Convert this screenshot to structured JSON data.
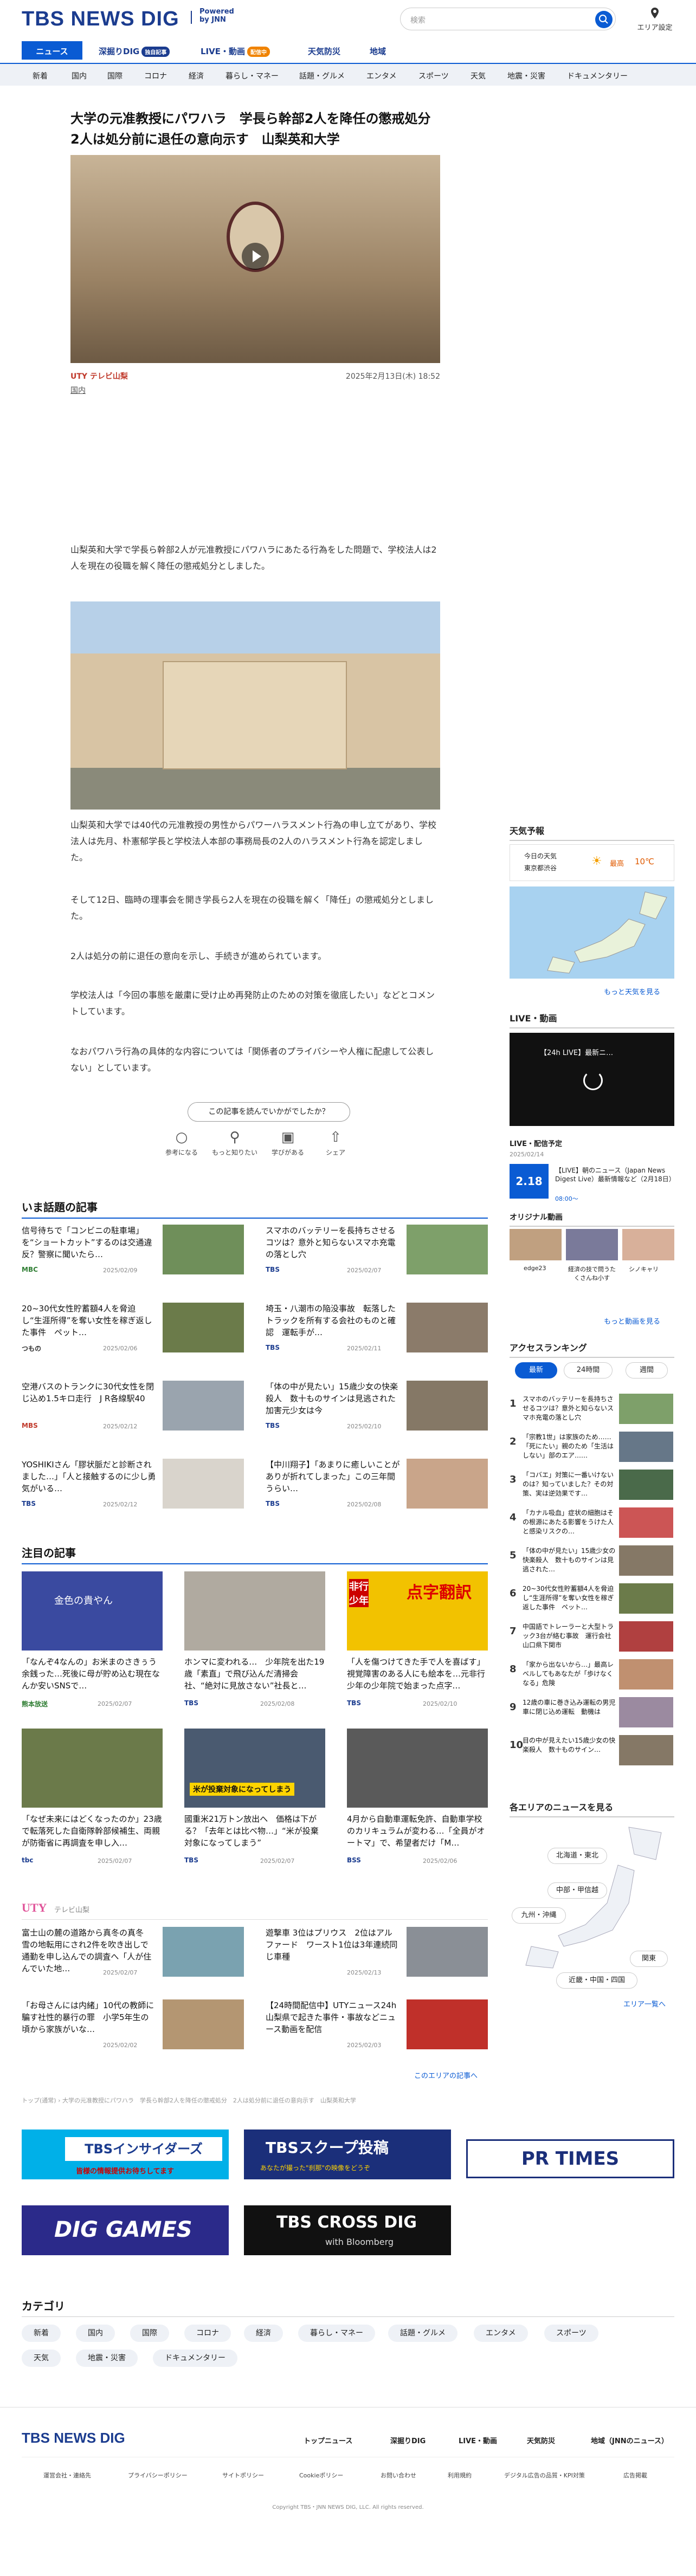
{
  "header": {
    "logo": "TBS NEWS DIG",
    "powered": "Powered by JNN",
    "search_placeholder": "検索",
    "area_label": "エリア設定"
  },
  "nav": {
    "items": [
      "ニュース",
      "深掘りDIG",
      "LIVE・動画",
      "天気防災",
      "地域"
    ],
    "badges": [
      "独自記事",
      "配信中"
    ]
  },
  "categories": [
    "新着",
    "国内",
    "国際",
    "コロナ",
    "経済",
    "暮らし・マネー",
    "話題・グルメ",
    "エンタメ",
    "スポーツ",
    "天気",
    "地震・災害",
    "ドキュメンタリー"
  ],
  "article": {
    "title": "大学の元准教授にパワハラ　学長ら幹部2人を降任の懲戒処分　2人は処分前に退任の意向示す　山梨英和大学",
    "source": "UTY テレビ山梨",
    "datetime": "2025年2月13日(木) 18:52",
    "category": "国内",
    "paragraphs": [
      "山梨英和大学で学長ら幹部2人が元准教授にパワハラにあたる行為をした問題で、学校法人は2人を現在の役職を解く降任の懲戒処分としました。",
      "山梨英和大学では40代の元准教授の男性からパワーハラスメント行為の申し立てがあり、学校法人は先月、朴憲郁学長と学校法人本部の事務局長の2人のハラスメント行為を認定しました。",
      "そして12日、臨時の理事会を開き学長ら2人を現在の役職を解く「降任」の懲戒処分としました。",
      "2人は処分の前に退任の意向を示し、手続きが進められています。",
      "学校法人は「今回の事態を厳粛に受け止め再発防止のための対策を徹底したい」などとコメントしています。",
      "なおパワハラ行為の具体的な内容については「関係者のプライバシーや人権に配慮して公表しない」としています。"
    ],
    "feedback_prompt": "この記事を読んでいかがでしたか？",
    "feedback_options": [
      "参考になる",
      "もっと知りたい",
      "学びがある",
      "シェア"
    ]
  },
  "hot_topics": {
    "heading": "いま話題の記事",
    "items": [
      {
        "title": "信号待ちで「コンビニの駐車場」を“ショートカット”するのは交通違反？警察に聞いたら…",
        "source": "MBC",
        "date": "2025/02/09"
      },
      {
        "title": "スマホのバッテリーを長持ちさせるコツは？意外と知らないスマホ充電の落とし穴",
        "source": "TBS",
        "date": "2025/02/07"
      },
      {
        "title": "20~30代女性貯蓄額4人を脅迫し“生涯所得”を奪い女性を稼ぎ返した事件　ペット…",
        "source": "つもの",
        "date": "2025/02/06"
      },
      {
        "title": "埼玉・八潮市の陥没事故　転落したトラックを所有する会社のものと確認　運転手が…",
        "source": "TBS",
        "date": "2025/02/11"
      },
      {
        "title": "空港バスのトランクに30代女性を閉じ込め1.5キロ走行　J R各線駅40",
        "source": "MBS",
        "date": "2025/02/12"
      },
      {
        "title": "「体の中が見たい」15歳少女の快楽殺人　数十ものサインは見逃された　加害元少女は今",
        "source": "TBS",
        "date": "2025/02/10"
      },
      {
        "title": "YOSHIKIさん「膠状脈だと診断されました…」「人と接触するのに少し勇気がいる…",
        "source": "TBS",
        "date": "2025/02/12"
      },
      {
        "title": "【中川翔子】「あまりに癒しいことがありが折れてしまった」この三年間うらい…",
        "source": "TBS",
        "date": "2025/02/08"
      }
    ]
  },
  "featured": {
    "heading": "注目の記事",
    "items": [
      {
        "title": "「なんぞ4なんの」お米まのさきぅう余銭った…死後に母が貯め込む現在なんか安いSNSで…",
        "source": "熊本放送",
        "date": "2025/02/07"
      },
      {
        "title": "ホンマに変われる…　少年院を出た19歳「素直」で飛び込んだ清掃会社、“絶対に見放さない”社長と…",
        "source": "TBS",
        "date": "2025/02/08"
      },
      {
        "title": "「人を傷つけてきた手で人を喜ばす」視覚障害のある人にも絵本を…元非行少年の少年院で始まった点字…",
        "source": "TBS",
        "date": "2025/02/10"
      },
      {
        "title": "「なぜ未来にはどくなったのか」23歳で転落死した自衛隊幹部候補生、両親が防衛省に再調査を申し入…",
        "source": "tbc",
        "date": "2025/02/07"
      },
      {
        "title": "國重米21万トン放出へ　価格は下がる？「去年とは比べ物…」“米が投棄対象になってしまう”",
        "source": "TBS",
        "date": "2025/02/07"
      },
      {
        "title": "4月から自動車運転免許、自動車学校のカリキュラムが変わる…「全員がオートマ」で、希望者だけ「M…",
        "source": "BSS",
        "date": "2025/02/06"
      }
    ],
    "thumb_texts": [
      "金色の貴やん",
      "点字翻訳",
      "非行少年",
      "米が投棄対象になってしまう"
    ]
  },
  "local": {
    "label": "UTY",
    "sublabel": "テレビ山梨",
    "items": [
      {
        "title": "富士山の麓の道路から真冬の真冬　雪の地転用にされ2件を吹き出しで通勤を申し込んでの調査へ「人が住んでいた地…",
        "date": "2025/02/07"
      },
      {
        "title": "遊撃車 3位はプリウス　2位はアルファード　ワースト1位は3年連続同じ車種",
        "date": "2025/02/13"
      },
      {
        "title": "「お母さんには内緒」10代の教師に騙す社性的暴行の罪　小学5年生の頃から家族がいな…",
        "date": "2025/02/02"
      },
      {
        "title": "【24時間配信中】UTYニュース24h　山梨県で起きた事件・事故などニュース動画を配信",
        "date": "2025/02/03"
      }
    ],
    "more": "このエリアの記事へ"
  },
  "breadcrumb": [
    "トップ(通常)",
    "大学の元准教授にパワハラ　学長ら幹部2人を降任の懲戒処分　2人は処分前に退任の意向示す　山梨英和大学"
  ],
  "banners": [
    "TBSインサイダーズ",
    "皆様の情報提供お待ちしてます",
    "TBSスクープ投稿",
    "あなたが撮った\"刹那\"の映像をどうぞ",
    "PR TIMES",
    "DIG GAMES",
    "TBS CROSS DIG",
    "with Bloomberg"
  ],
  "sidebar": {
    "weather_heading": "天気予報",
    "weather_label": "今日の天気",
    "weather_place": "東京都渋谷",
    "weather_temp_label": "最高",
    "weather_temp": "10℃",
    "weather_more": "もっと天気を見る",
    "live_heading": "LIVE・動画",
    "live_title": "【24h LIVE】最新ニ…",
    "schedule_heading": "LIVE・配信予定",
    "schedule_date": "2025/02/14",
    "schedule_time": "2.18",
    "schedule_title": "【LIVE】朝のニュース（Japan News Digest Live）最新情報など（2月18日）",
    "schedule_start": "08:00～",
    "original_heading": "オリジナル動画",
    "original_items": [
      "edge23",
      "経済の技で問うたくさんね小す",
      "シノキャリ"
    ],
    "original_more": "もっと動画を見る",
    "ranking_heading": "アクセスランキング",
    "ranking_tabs": [
      "最新",
      "24時間",
      "週間"
    ],
    "ranking_items": [
      "スマホのバッテリーを長持ちさせるコツは？意外と知らないスマホ充電の落とし穴",
      "「宗教1世」は家族のため……「死にたい」親のため「生活はしない」部のエア……",
      "「コバエ」対策に一番いけないのは？知っていました？その対策、実は逆効果です…",
      "「カナル吸血」症状の細胞はその根源にあたる影響をうけた人と感染リスクの…",
      "「体の中が見たい」15歳少女の快楽殺人　数十ものサインは見逃された…",
      "20~30代女性貯蓄額4人を脅迫し“生涯所得”を奪い女性を稼ぎ返した事件　ペット…",
      "中国語でトレーラーと大型トラック3台が絡む事故　運行会社　山口県下関市",
      "「家から出ないから…」最高レベルしてもあなたが「歩けなくなる」危険",
      "12歳の車に巻き込み運転の男児　車に閉じ込め運転　動機は",
      "目の中が見えたい15歳少女の快楽殺人　数十ものサイン…"
    ],
    "ranking_numbers": [
      "1",
      "2",
      "3",
      "4",
      "5",
      "6",
      "7",
      "8",
      "9",
      "10"
    ],
    "area_heading": "各エリアのニュースを見る",
    "area_buttons": [
      "北海道・東北",
      "中部・甲信越",
      "九州・沖縄",
      "関東",
      "近畿・中国・四国"
    ],
    "area_more": "エリア一覧へ"
  },
  "category_section": {
    "heading": "カテゴリ",
    "items": [
      "新着",
      "国内",
      "国際",
      "コロナ",
      "経済",
      "暮らし・マネー",
      "話題・グルメ",
      "エンタメ",
      "スポーツ",
      "天気",
      "地震・災害",
      "ドキュメンタリー"
    ]
  },
  "footer": {
    "logo": "TBS NEWS DIG",
    "nav": [
      "トップニュース",
      "深掘りDIG",
      "LIVE・動画",
      "天気防災",
      "地域（JNNのニュース）"
    ],
    "links": [
      "運営会社・連絡先",
      "プライバシーポリシー",
      "サイトポリシー",
      "Cookieポリシー",
      "お問い合わせ",
      "利用規約",
      "デジタル広告の品質・KPI対策",
      "広告掲載"
    ],
    "copyright": "Copyright TBS・JNN NEWS DIG, LLC. All rights reserved."
  },
  "colors": {
    "brand": "#1b3c8f",
    "accent": "#0a5bd3",
    "live": "#f08300",
    "ranking_tab": "#0a5bd3"
  }
}
